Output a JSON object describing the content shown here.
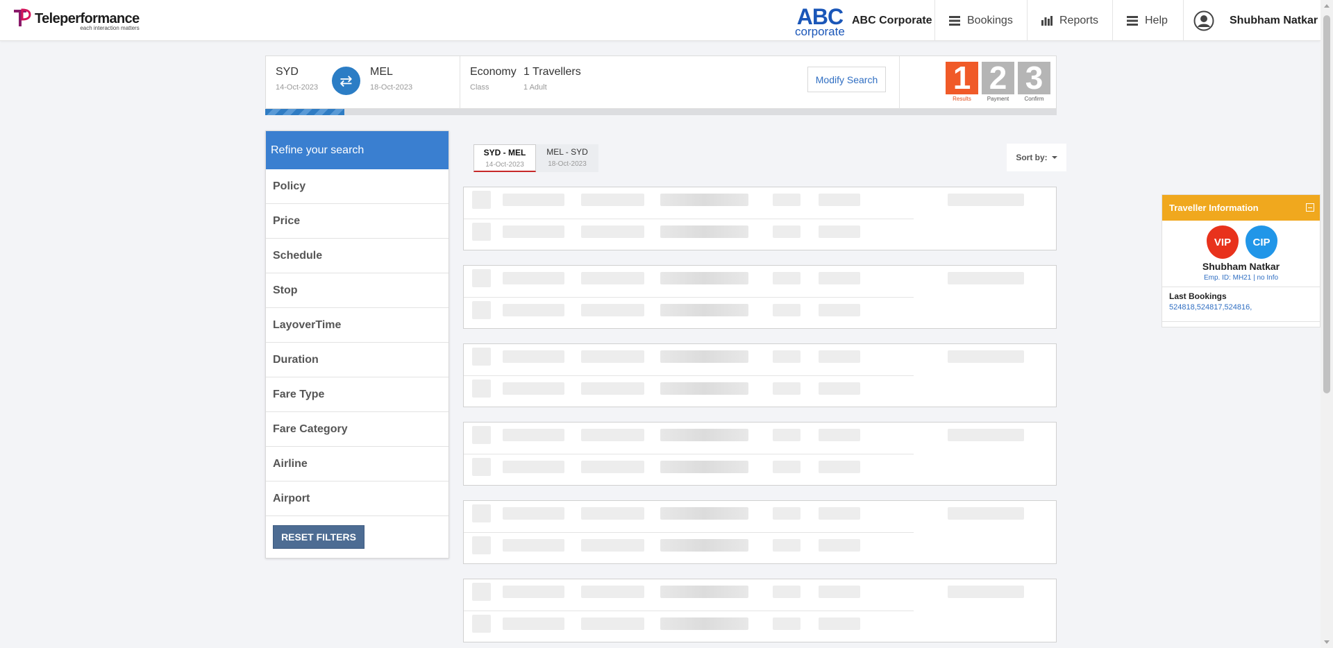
{
  "header": {
    "brand": {
      "name": "Teleperformance",
      "tagline": "each interaction matters"
    },
    "corporate_logo": {
      "line1": "ABC",
      "line2": "corporate"
    },
    "corporate_name": "ABC Corporate",
    "nav": {
      "bookings": "Bookings",
      "reports": "Reports",
      "help": "Help"
    },
    "user_name": "Shubham Natkar"
  },
  "search_summary": {
    "origin": {
      "city": "SYD",
      "date": "14-Oct-2023"
    },
    "destination": {
      "city": "MEL",
      "date": "18-Oct-2023"
    },
    "cabin": {
      "value": "Economy",
      "label": "Class"
    },
    "travellers": {
      "value": "1 Travellers",
      "label": "1 Adult"
    },
    "modify_button": "Modify Search"
  },
  "steps": [
    {
      "num": "1",
      "label": "Results",
      "active": true
    },
    {
      "num": "2",
      "label": "Payment",
      "active": false
    },
    {
      "num": "3",
      "label": "Confirm",
      "active": false
    }
  ],
  "progress": 0.1,
  "refine": {
    "title": "Refine your search",
    "items": [
      "Policy",
      "Price",
      "Schedule",
      "Stop",
      "LayoverTime",
      "Duration",
      "Fare Type",
      "Fare Category",
      "Airline",
      "Airport"
    ],
    "reset_button": "RESET FILTERS"
  },
  "legs": [
    {
      "route": "SYD - MEL",
      "date": "14-Oct-2023",
      "active": true
    },
    {
      "route": "MEL - SYD",
      "date": "18-Oct-2023",
      "active": false
    }
  ],
  "sort": {
    "label": "Sort by:"
  },
  "traveller_info": {
    "title": "Traveller Information",
    "badges": [
      "VIP",
      "CIP"
    ],
    "name": "Shubham Natkar",
    "emp_info": "Emp. ID: MH21 | no Info",
    "last_bookings_label": "Last Bookings",
    "last_bookings": "524818,524817,524816,"
  },
  "colors": {
    "accent_blue": "#3a7fd0",
    "step_active": "#f05a28",
    "traveller_header": "#f0a81e",
    "vip": "#e8321c",
    "cip": "#2196e8"
  }
}
